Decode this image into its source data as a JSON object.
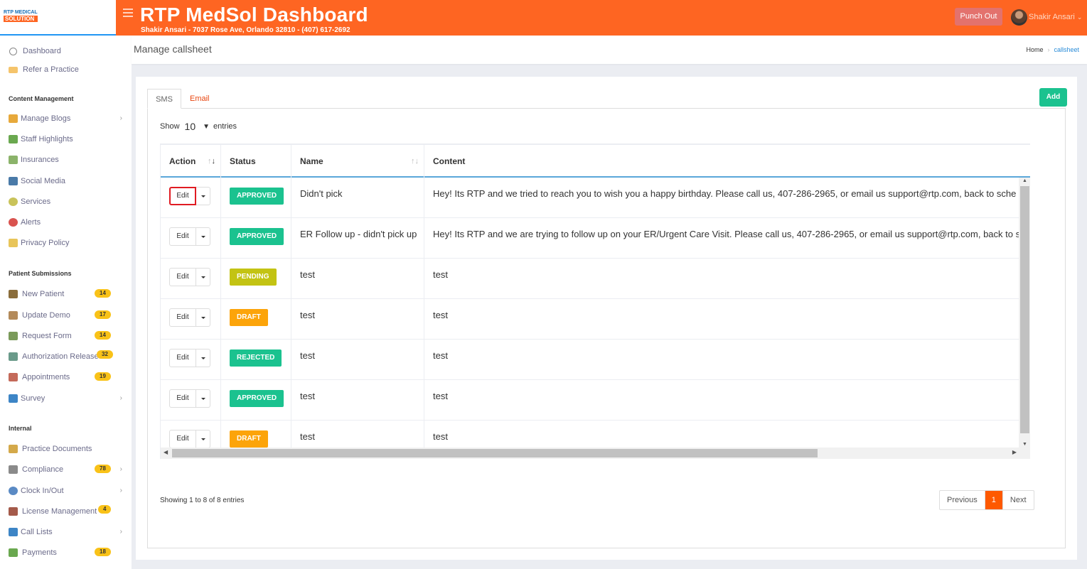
{
  "header": {
    "logo_line1": "RTP MEDICAL",
    "logo_line2": "SOLUTION",
    "title": "RTP MedSol Dashboard",
    "subtitle": "Shakir Ansari - 7037 Rose Ave, Orlando 32810 - (407) 617-2692",
    "punch_out_label": "Punch Out",
    "user_name": "Shakir Ansari",
    "brand_color": "#fe6522"
  },
  "sidebar": {
    "top_items": [
      {
        "label": "Dashboard",
        "icon": "dashboard-icon"
      },
      {
        "label": "Refer a Practice",
        "icon": "envelope-icon"
      }
    ],
    "sections": [
      {
        "heading": "Content Management",
        "items": [
          {
            "label": "Manage Blogs",
            "icon": "blog-icon",
            "chevron": true
          },
          {
            "label": "Staff Highlights",
            "icon": "staff-icon"
          },
          {
            "label": "Insurances",
            "icon": "insurance-icon"
          },
          {
            "label": "Social Media",
            "icon": "social-media-icon"
          },
          {
            "label": "Services",
            "icon": "services-icon"
          },
          {
            "label": "Alerts",
            "icon": "alert-icon"
          },
          {
            "label": "Privacy Policy",
            "icon": "lock-icon"
          }
        ]
      },
      {
        "heading": "Patient Submissions",
        "items": [
          {
            "label": "New Patient",
            "icon": "clipboard-icon",
            "badge": "14"
          },
          {
            "label": "Update Demo",
            "icon": "update-icon",
            "badge": "17"
          },
          {
            "label": "Request Form",
            "icon": "form-icon",
            "badge": "14"
          },
          {
            "label": "Authorization Release",
            "icon": "authorization-icon",
            "badge": "32"
          },
          {
            "label": "Appointments",
            "icon": "calendar-icon",
            "badge": "19"
          },
          {
            "label": "Survey",
            "icon": "survey-icon",
            "chevron": true
          }
        ]
      },
      {
        "heading": "Internal",
        "items": [
          {
            "label": "Practice Documents",
            "icon": "documents-icon"
          },
          {
            "label": "Compliance",
            "icon": "compliance-icon",
            "badge": "78",
            "chevron": true
          },
          {
            "label": "Clock In/Out",
            "icon": "clock-icon",
            "chevron": true
          },
          {
            "label": "License Management",
            "icon": "license-icon",
            "badge": "4"
          },
          {
            "label": "Call Lists",
            "icon": "phone-list-icon",
            "chevron": true
          },
          {
            "label": "Payments",
            "icon": "money-icon",
            "badge": "18"
          }
        ]
      }
    ]
  },
  "subheader": {
    "page_title": "Manage callsheet",
    "breadcrumb_home": "Home",
    "breadcrumb_current": "callsheet"
  },
  "tabs": [
    {
      "label": "SMS",
      "active": true
    },
    {
      "label": "Email",
      "active": false
    }
  ],
  "toolbar": {
    "add_label": "Add",
    "show_label": "Show",
    "entries_value": "10",
    "entries_label": "entries"
  },
  "table": {
    "columns": [
      "Action",
      "Status",
      "Name",
      "Content"
    ],
    "edit_label": "Edit",
    "rows": [
      {
        "status": "APPROVED",
        "status_color": "#1bc28f",
        "name": "Didn't pick",
        "content": "Hey! Its RTP and we tried to reach you to wish you a happy birthday. Please call us, 407-286-2965, or email us support@rtp.com, back to sche"
      },
      {
        "status": "APPROVED",
        "status_color": "#1bc28f",
        "name": "ER Follow up - didn't pick up",
        "content": "Hey! Its RTP and we are trying to follow up on your ER/Urgent Care Visit. Please call us, 407-286-2965, or email us support@rtp.com, back to s"
      },
      {
        "status": "PENDING",
        "status_color": "#c3c313",
        "name": "test",
        "content": "test"
      },
      {
        "status": "DRAFT",
        "status_color": "#fca40a",
        "name": "test",
        "content": "test"
      },
      {
        "status": "REJECTED",
        "status_color": "#1bc28f",
        "name": "test",
        "content": "test"
      },
      {
        "status": "APPROVED",
        "status_color": "#1bc28f",
        "name": "test",
        "content": "test"
      },
      {
        "status": "DRAFT",
        "status_color": "#fca40a",
        "name": "test",
        "content": "test"
      },
      {
        "status": "",
        "status_color": "#fca40a",
        "name": "",
        "content": ""
      }
    ],
    "info": "Showing 1 to 8 of 8 entries"
  },
  "pagination": {
    "previous": "Previous",
    "current": "1",
    "next": "Next"
  }
}
